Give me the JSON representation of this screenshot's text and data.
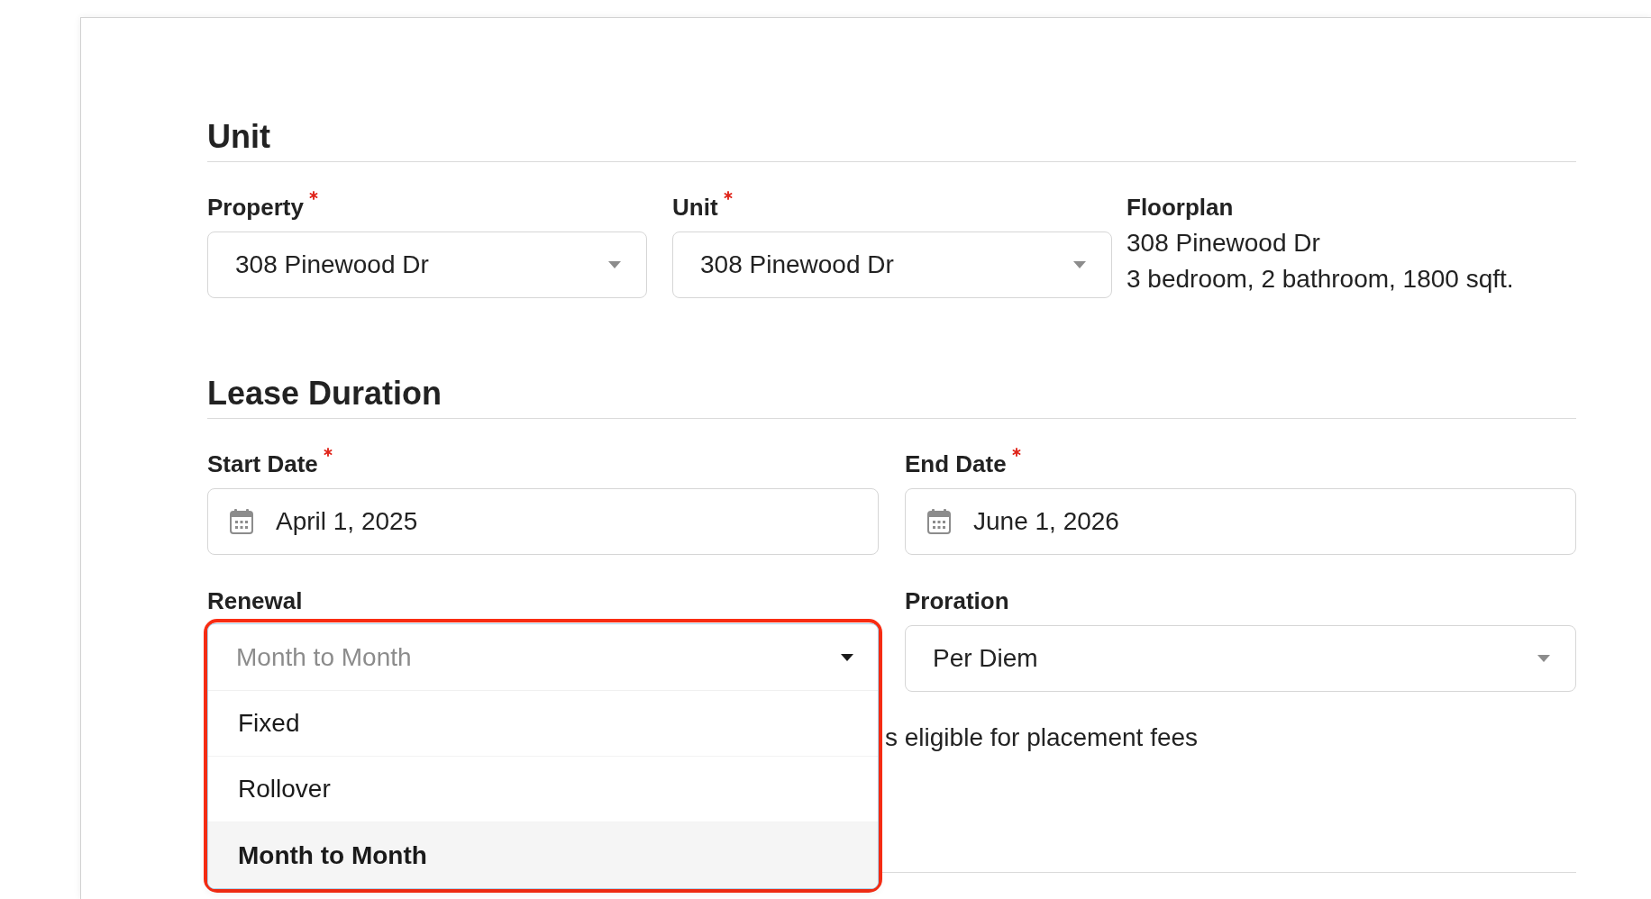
{
  "unit_section": {
    "title": "Unit",
    "property": {
      "label": "Property",
      "required": true,
      "value": "308 Pinewood Dr",
      "expanded": false
    },
    "unit": {
      "label": "Unit",
      "required": true,
      "value": "308 Pinewood Dr",
      "expanded": false
    },
    "floorplan": {
      "label": "Floorplan",
      "lines": [
        "308 Pinewood Dr",
        "3 bedroom, 2 bathroom, 1800 sqft."
      ]
    }
  },
  "lease_duration_section": {
    "title": "Lease Duration",
    "start_date": {
      "label": "Start Date",
      "required": true,
      "value": "April 1, 2025"
    },
    "end_date": {
      "label": "End Date",
      "required": true,
      "value": "June 1, 2026"
    },
    "renewal": {
      "label": "Renewal",
      "value": "Month to Month",
      "expanded": true,
      "highlighted": true,
      "options": [
        {
          "label": "Fixed",
          "selected": false
        },
        {
          "label": "Rollover",
          "selected": false
        },
        {
          "label": "Month to Month",
          "selected": true
        }
      ]
    },
    "proration": {
      "label": "Proration",
      "value": "Per Diem",
      "expanded": false
    },
    "placement_fee_note": "s eligible for placement fees"
  }
}
